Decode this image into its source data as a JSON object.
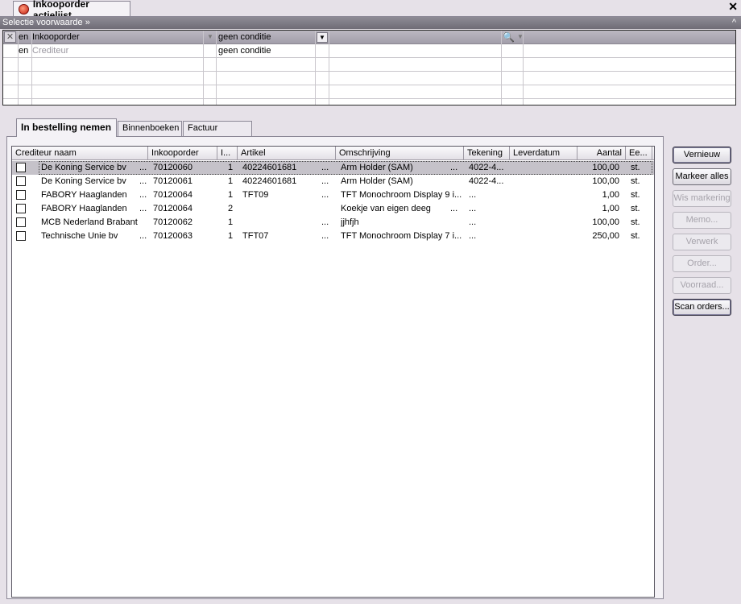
{
  "window": {
    "tab_title": "Inkooporder actielijst",
    "close_glyph": "✕"
  },
  "selection": {
    "header_label": "Selectie voorwaarde »",
    "collapse_glyph": "^",
    "rows": [
      {
        "conj": "en",
        "field": "Inkooporder",
        "condition": "geen conditie"
      },
      {
        "conj": "en",
        "field": "Crediteur",
        "condition": "geen conditie"
      }
    ]
  },
  "tabs": [
    {
      "label": "In bestelling nemen",
      "active": true
    },
    {
      "label": "Binnenboeken",
      "active": false
    },
    {
      "label": "Factuur boeken",
      "active": false
    }
  ],
  "table": {
    "columns": [
      "Crediteur naam",
      "Inkooporder",
      "I...",
      "Artikel",
      "Omschrijving",
      "Tekening",
      "Leverdatum",
      "Aantal",
      "Ee..."
    ],
    "rows": [
      {
        "crediteur": "De Koning Service bv",
        "dots1": "...",
        "order": "70120060",
        "line": "1",
        "artikel": "40224601681",
        "dots2": "...",
        "omschrijving": "Arm Holder (SAM)",
        "dots3": "...",
        "tekening": "4022-4...",
        "leverdatum": "",
        "aantal": "100,00",
        "eenheid": "st."
      },
      {
        "crediteur": "De Koning Service bv",
        "dots1": "...",
        "order": "70120061",
        "line": "1",
        "artikel": "40224601681",
        "dots2": "...",
        "omschrijving": "Arm Holder (SAM)",
        "dots3": "",
        "tekening": "4022-4...",
        "leverdatum": "",
        "aantal": "100,00",
        "eenheid": "st."
      },
      {
        "crediteur": "FABORY Haaglanden",
        "dots1": "...",
        "order": "70120064",
        "line": "1",
        "artikel": "TFT09",
        "dots2": "...",
        "omschrijving": "TFT Monochroom Display 9 i...",
        "dots3": "",
        "tekening": "...",
        "leverdatum": "",
        "aantal": "1,00",
        "eenheid": "st."
      },
      {
        "crediteur": "FABORY Haaglanden",
        "dots1": "...",
        "order": "70120064",
        "line": "2",
        "artikel": "",
        "dots2": "",
        "omschrijving": "Koekje van eigen deeg",
        "dots3": "...",
        "tekening": "...",
        "leverdatum": "",
        "aantal": "1,00",
        "eenheid": "st."
      },
      {
        "crediteur": "MCB Nederland Brabant ...",
        "dots1": "",
        "order": "70120062",
        "line": "1",
        "artikel": "",
        "dots2": "...",
        "omschrijving": "jjhfjh",
        "dots3": "",
        "tekening": "...",
        "leverdatum": "",
        "aantal": "100,00",
        "eenheid": "st."
      },
      {
        "crediteur": "Technische Unie bv",
        "dots1": "...",
        "order": "70120063",
        "line": "1",
        "artikel": "TFT07",
        "dots2": "...",
        "omschrijving": "TFT Monochroom Display 7 i...",
        "dots3": "",
        "tekening": "...",
        "leverdatum": "",
        "aantal": "250,00",
        "eenheid": "st."
      }
    ]
  },
  "buttons": [
    {
      "label": "Vernieuw",
      "enabled": true
    },
    {
      "label": "Markeer alles",
      "enabled": true
    },
    {
      "label": "Wis markering",
      "enabled": false
    },
    {
      "label": "Memo...",
      "enabled": false
    },
    {
      "label": "Verwerk",
      "enabled": false
    },
    {
      "label": "Order...",
      "enabled": false
    },
    {
      "label": "Voorraad...",
      "enabled": false
    },
    {
      "label": "Scan orders...",
      "enabled": true
    }
  ]
}
